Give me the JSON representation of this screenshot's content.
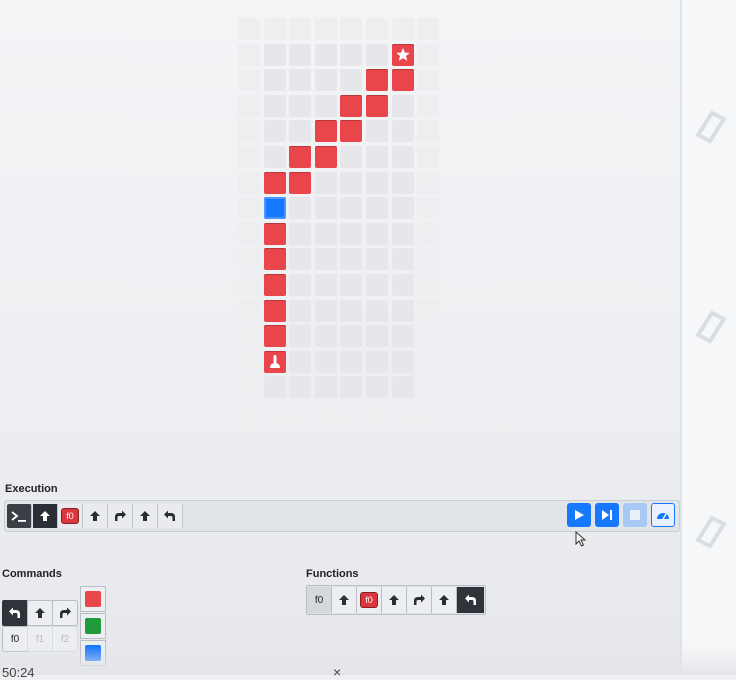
{
  "execution": {
    "label": "Execution",
    "slots": [
      "terminal-icon",
      "arrow-up-icon",
      "f0",
      "arrow-up-icon",
      "turn-right-icon",
      "arrow-up-icon",
      "turn-left-icon"
    ],
    "f0_label": "f0",
    "controls": [
      "play-icon",
      "step-icon",
      "stop-icon",
      "speed-icon"
    ]
  },
  "commands": {
    "label": "Commands",
    "f0": "f0",
    "f1": "f1",
    "f2": "f2",
    "colors": [
      "#e8464b",
      "#1f9b3a",
      "#1677ff"
    ]
  },
  "functions": {
    "label": "Functions",
    "f0": "f0",
    "f0_badge": "f0"
  },
  "board": {
    "colors": {
      "red": "#e8464b",
      "blue": "#1677ff",
      "empty": "#e5e7ea"
    }
  },
  "player": {
    "timestamp": "50:24",
    "close": "×"
  }
}
